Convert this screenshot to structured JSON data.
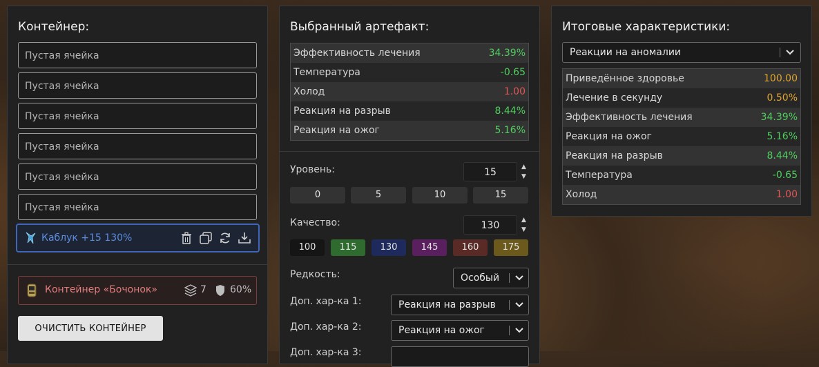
{
  "container": {
    "title": "Контейнер:",
    "slots": [
      "Пустая ячейка",
      "Пустая ячейка",
      "Пустая ячейка",
      "Пустая ячейка",
      "Пустая ячейка",
      "Пустая ячейка"
    ],
    "filled_slot": {
      "label": "Каблук +15 130%",
      "icon": "heel-artifact-icon"
    },
    "barrel": {
      "label": "Контейнер «Бочонок»",
      "slots_count": "7",
      "protection": "60%"
    },
    "clear_button": "ОЧИСТИТЬ КОНТЕЙНЕР"
  },
  "artifact": {
    "title": "Выбранный артефакт:",
    "stats": [
      {
        "label": "Эффективность лечения",
        "value": "34.39%",
        "tone": "pos"
      },
      {
        "label": "Температура",
        "value": "-0.65",
        "tone": "pos"
      },
      {
        "label": "Холод",
        "value": "1.00",
        "tone": "neg"
      },
      {
        "label": "Реакция на разрыв",
        "value": "8.44%",
        "tone": "pos"
      },
      {
        "label": "Реакция на ожог",
        "value": "5.16%",
        "tone": "pos"
      }
    ],
    "level": {
      "label": "Уровень:",
      "value": "15",
      "presets": [
        "0",
        "5",
        "10",
        "15"
      ]
    },
    "quality": {
      "label": "Качество:",
      "value": "130",
      "presets": [
        {
          "v": "100",
          "color": "#1a1a1a"
        },
        {
          "v": "115",
          "color": "#2f6b2f"
        },
        {
          "v": "130",
          "color": "#1f2a5c"
        },
        {
          "v": "145",
          "color": "#5a1f5e"
        },
        {
          "v": "160",
          "color": "#5a2a26"
        },
        {
          "v": "175",
          "color": "#6b5a1c"
        }
      ]
    },
    "rarity": {
      "label": "Редкость:",
      "value": "Особый"
    },
    "extra1": {
      "label": "Доп. хар-ка 1:",
      "value": "Реакция на разрыв"
    },
    "extra2": {
      "label": "Доп. хар-ка 2:",
      "value": "Реакция на ожог"
    },
    "extra3": {
      "label": "Доп. хар-ка 3:"
    }
  },
  "totals": {
    "title": "Итоговые характеристики:",
    "filter": "Реакции на аномалии",
    "stats": [
      {
        "label": "Приведённое здоровье",
        "value": "100.00",
        "tone": "amb"
      },
      {
        "label": "Лечение в секунду",
        "value": "0.50%",
        "tone": "amb"
      },
      {
        "label": "Эффективность лечения",
        "value": "34.39%",
        "tone": "pos"
      },
      {
        "label": "Реакция на ожог",
        "value": "5.16%",
        "tone": "pos"
      },
      {
        "label": "Реакция на разрыв",
        "value": "8.44%",
        "tone": "pos"
      },
      {
        "label": "Температура",
        "value": "-0.65",
        "tone": "pos"
      },
      {
        "label": "Холод",
        "value": "1.00",
        "tone": "neg"
      }
    ]
  }
}
